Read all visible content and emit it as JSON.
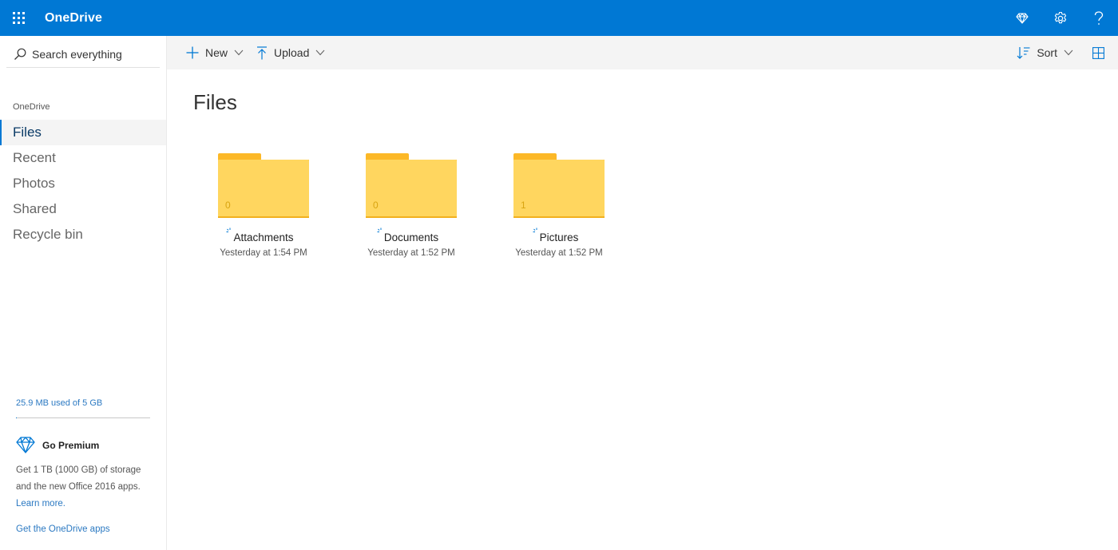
{
  "app": {
    "title": "OneDrive"
  },
  "top_icons": [
    "diamond-icon",
    "settings-gear-icon",
    "help-icon"
  ],
  "search": {
    "placeholder": "Search everything"
  },
  "nav": {
    "heading": "OneDrive",
    "items": [
      {
        "label": "Files",
        "active": true
      },
      {
        "label": "Recent",
        "active": false
      },
      {
        "label": "Photos",
        "active": false
      },
      {
        "label": "Shared",
        "active": false
      },
      {
        "label": "Recycle bin",
        "active": false
      }
    ]
  },
  "storage": {
    "text": "25.9 MB used of 5 GB",
    "used_fraction": 0.005
  },
  "premium": {
    "title": "Go Premium",
    "description": "Get 1 TB (1000 GB) of storage and the new Office 2016 apps.",
    "link": "Learn more."
  },
  "get_apps": "Get the OneDrive apps",
  "commands": {
    "new_label": "New",
    "upload_label": "Upload",
    "sort_label": "Sort"
  },
  "main": {
    "title": "Files"
  },
  "folders": [
    {
      "name": "Attachments",
      "count": "0",
      "modified": "Yesterday at 1:54 PM",
      "has_items": false
    },
    {
      "name": "Documents",
      "count": "0",
      "modified": "Yesterday at 1:52 PM",
      "has_items": false
    },
    {
      "name": "Pictures",
      "count": "1",
      "modified": "Yesterday at 1:52 PM",
      "has_items": true
    }
  ],
  "colors": {
    "brand": "#0078d4",
    "folder": "#ffd65f",
    "folder_tab": "#fcb827",
    "link": "#2b79c2"
  }
}
